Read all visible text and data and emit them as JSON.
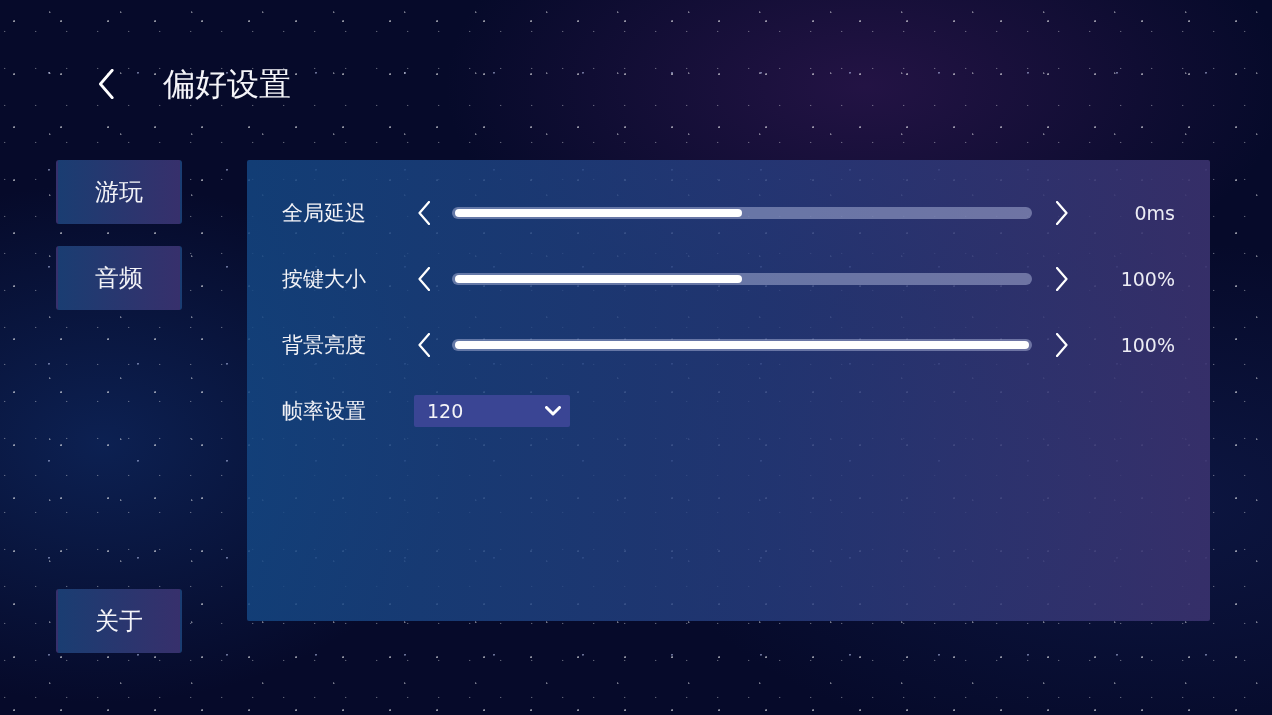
{
  "header": {
    "title": "偏好设置"
  },
  "sidebar": {
    "items": [
      {
        "label": "游玩",
        "selected": false
      },
      {
        "label": "音频",
        "selected": false
      }
    ],
    "footer_button": {
      "label": "关于"
    }
  },
  "settings": [
    {
      "kind": "slider",
      "label": "全局延迟",
      "level": 0.5,
      "reading": "0ms"
    },
    {
      "kind": "slider",
      "label": "按键大小",
      "level": 0.5,
      "reading": "100%"
    },
    {
      "kind": "slider",
      "label": "背景亮度",
      "level": 1,
      "reading": "100%"
    },
    {
      "kind": "dropdown",
      "label": "帧率设置",
      "value": "120"
    }
  ]
}
